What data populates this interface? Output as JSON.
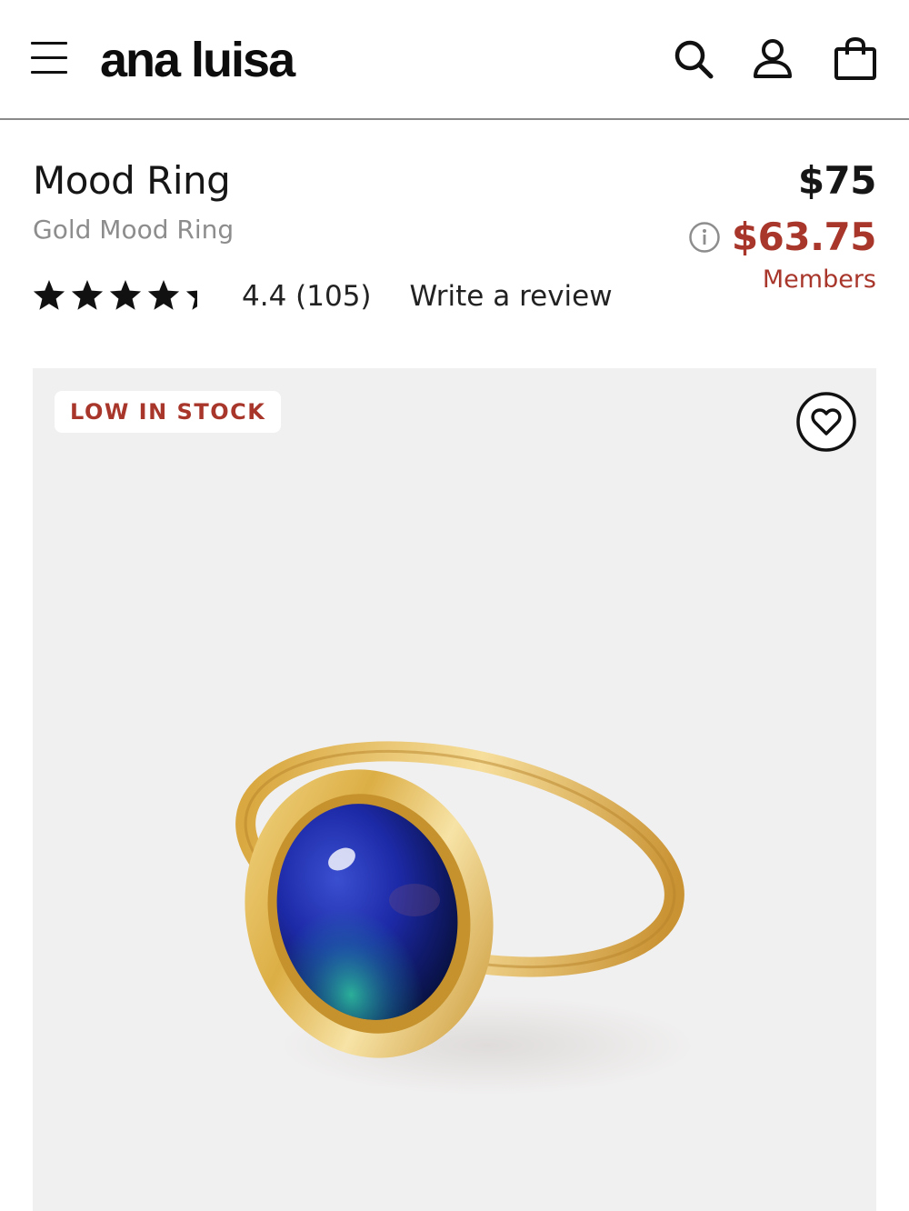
{
  "header": {
    "logo": "ana luisa",
    "icons": [
      "menu-icon",
      "search-icon",
      "account-icon",
      "shopping-bag-icon"
    ]
  },
  "product": {
    "title": "Mood Ring",
    "subtitle": "Gold Mood Ring",
    "price": "$75",
    "member_price": "$63.75",
    "members_label": "Members",
    "rating_stars": 4.4,
    "rating_text": "4.4 (105)",
    "write_review": "Write a review"
  },
  "gallery": {
    "badge": "LOW IN STOCK",
    "wishlist_icon": "heart-icon"
  },
  "colors": {
    "accent": "#a8362b",
    "text": "#161616",
    "muted": "#8d8d8d",
    "image_bg": "#f1f0f0"
  }
}
